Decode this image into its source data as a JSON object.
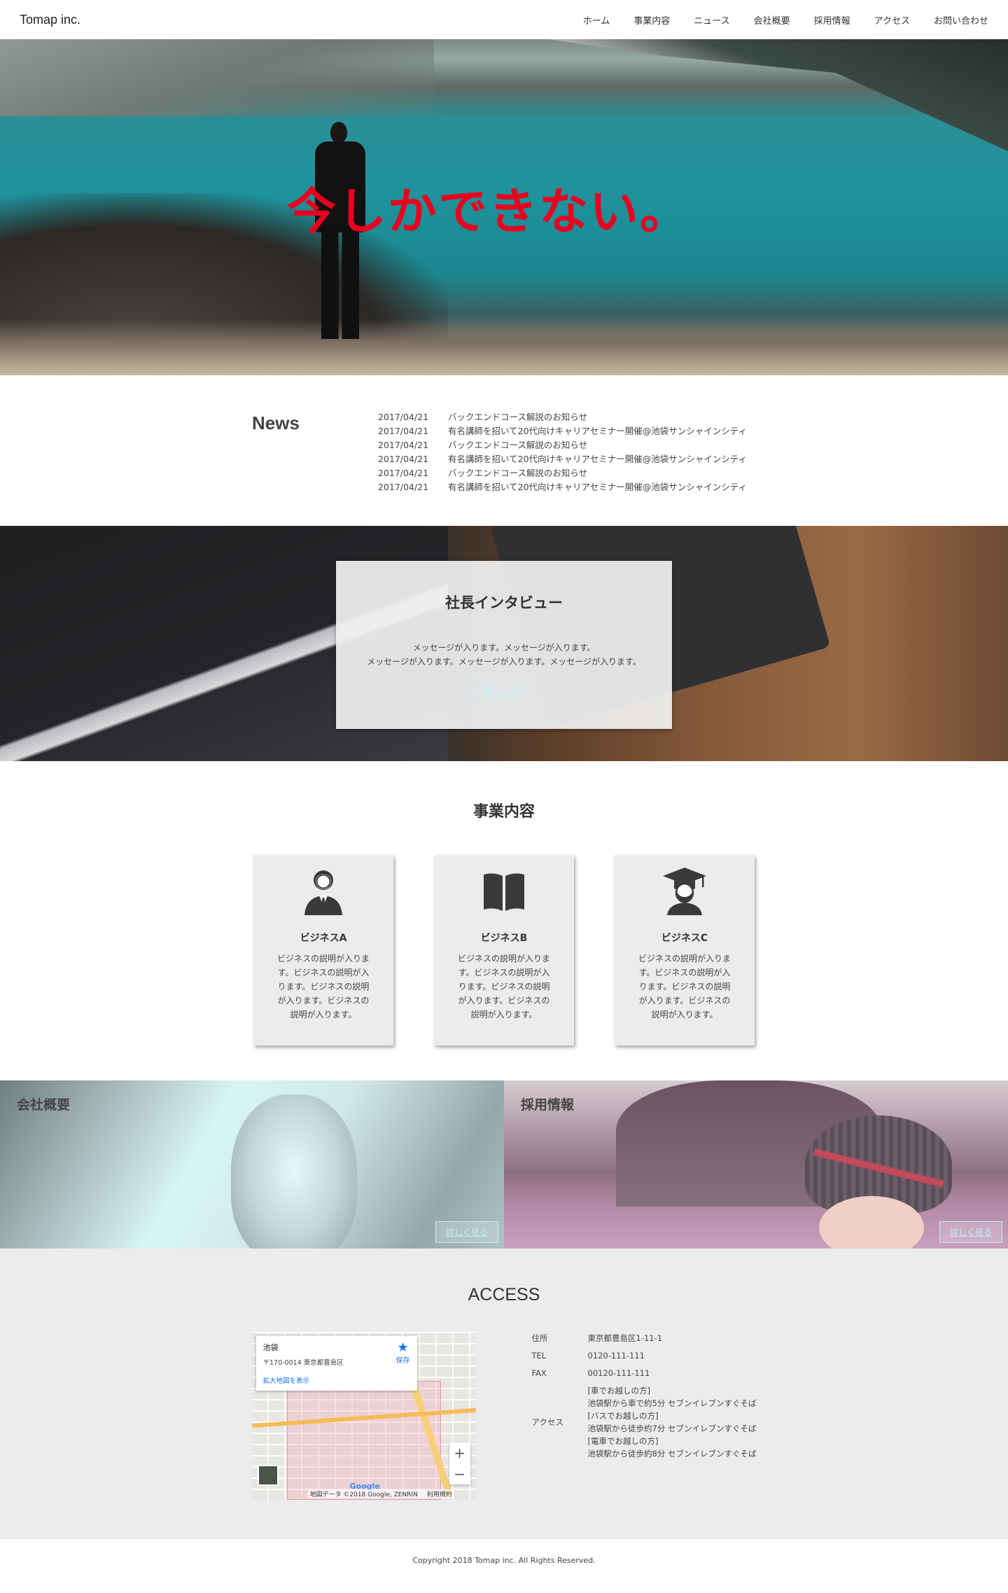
{
  "header": {
    "logo": "Tomap inc.",
    "nav": [
      "ホーム",
      "事業内容",
      "ニュース",
      "会社概要",
      "採用情報",
      "アクセス",
      "お問い合わせ"
    ]
  },
  "hero": {
    "title": "今しかできない。",
    "title_color": "#e8001f"
  },
  "news": {
    "title": "News",
    "items": [
      {
        "date": "2017/04/21",
        "text": "バックエンドコース解説のお知らせ"
      },
      {
        "date": "2017/04/21",
        "text": "有名講師を招いて20代向けキャリアセミナー開催@池袋サンシャインシティ"
      },
      {
        "date": "2017/04/21",
        "text": "バックエンドコース解説のお知らせ"
      },
      {
        "date": "2017/04/21",
        "text": "有名講師を招いて20代向けキャリアセミナー開催@池袋サンシャインシティ"
      },
      {
        "date": "2017/04/21",
        "text": "バックエンドコース解説のお知らせ"
      },
      {
        "date": "2017/04/21",
        "text": "有名講師を招いて20代向けキャリアセミナー開催@池袋サンシャインシティ"
      }
    ]
  },
  "interview": {
    "title": "社長インタビュー",
    "line1": "メッセージが入ります。メッセージが入ります。",
    "line2": "メッセージが入ります。メッセージが入ります。メッセージが入ります。",
    "button": "詳しく見る"
  },
  "services": {
    "title": "事業内容",
    "cards": [
      {
        "title": "ビジネスA",
        "text": "ビジネスの説明が入ります。ビジネスの説明が入ります。ビジネスの説明が入ります。ビジネスの説明が入ります。",
        "icon": "businessman-icon"
      },
      {
        "title": "ビジネスB",
        "text": "ビジネスの説明が入ります。ビジネスの説明が入ります。ビジネスの説明が入ります。ビジネスの説明が入ります。",
        "icon": "book-icon"
      },
      {
        "title": "ビジネスC",
        "text": "ビジネスの説明が入ります。ビジネスの説明が入ります。ビジネスの説明が入ります。ビジネスの説明が入ります。",
        "icon": "graduate-icon"
      }
    ]
  },
  "panels": {
    "company": {
      "label": "会社概要",
      "button": "詳しく見る"
    },
    "recruit": {
      "label": "採用情報",
      "button": "詳しく見る"
    }
  },
  "access": {
    "title": "ACCESS",
    "map": {
      "place": "池袋",
      "address": "〒170-0014 東京都豊島区",
      "enlarge": "拡大地図を表示",
      "save": "保存",
      "zoom_in": "+",
      "zoom_out": "−",
      "google": "Google",
      "attribution": "地図データ ©2018 Google, ZENRIN",
      "terms": "利用規約"
    },
    "info": {
      "address_label": "住所",
      "address": "東京都豊島区1-11-1",
      "tel_label": "TEL",
      "tel": "0120-111-111",
      "fax_label": "FAX",
      "fax": "00120-111-111",
      "access_label": "アクセス",
      "access_lines": [
        "[車でお越しの方]",
        "池袋駅から車で約5分 セブンイレブンすぐそば",
        "[バスでお越しの方]",
        "池袋駅から徒歩約7分 セブンイレブンすぐそば",
        "[電車でお越しの方]",
        "池袋駅から徒歩約8分 セブンイレブンすぐそば"
      ]
    }
  },
  "footer": {
    "copyright": "Copyright 2018 Tomap inc. All Rights Reserved."
  },
  "colors": {
    "accent_red": "#e8001f",
    "button_outline": "#bfefff",
    "access_bg": "#ececec"
  }
}
